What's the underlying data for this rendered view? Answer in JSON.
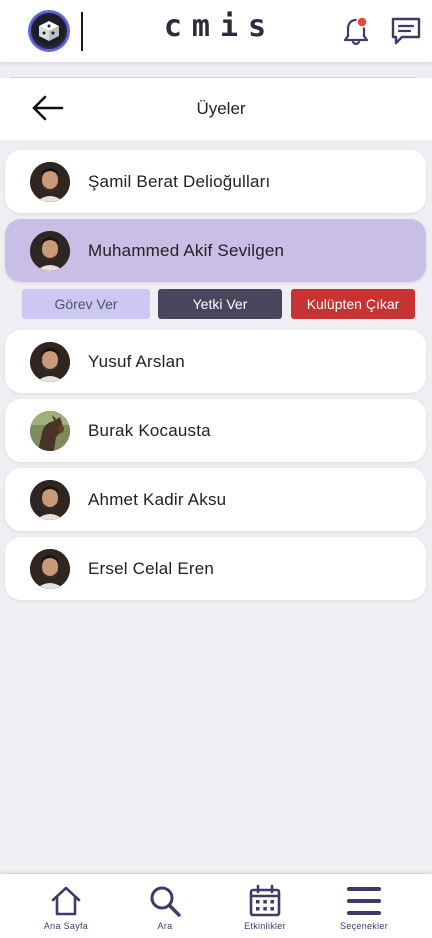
{
  "app": {
    "brand": "cmis",
    "notification_dot_color": "#e8453c",
    "accent": "#3d3a6b"
  },
  "header": {
    "title": "Üyeler"
  },
  "members": [
    {
      "name": "Şamil Berat Delioğulları",
      "avatar": "man-portrait",
      "selected": false
    },
    {
      "name": "Muhammed Akif Sevilgen",
      "avatar": "man-portrait",
      "selected": true
    },
    {
      "name": "Yusuf Arslan",
      "avatar": "man-portrait",
      "selected": false
    },
    {
      "name": "Burak Kocausta",
      "avatar": "horse-photo",
      "selected": false
    },
    {
      "name": "Ahmet Kadir Aksu",
      "avatar": "man-portrait",
      "selected": false
    },
    {
      "name": "Ersel Celal Eren",
      "avatar": "man-portrait",
      "selected": false
    }
  ],
  "actions": {
    "assign_role": "Görev Ver",
    "grant_permission": "Yetki Ver",
    "remove_from_club": "Kulüpten Çıkar"
  },
  "bottom_nav": [
    {
      "label": "Ana Sayfa",
      "icon": "home-icon"
    },
    {
      "label": "Ara",
      "icon": "search-icon"
    },
    {
      "label": "Etkinlikler",
      "icon": "calendar-icon"
    },
    {
      "label": "Seçenekler",
      "icon": "menu-icon"
    }
  ]
}
